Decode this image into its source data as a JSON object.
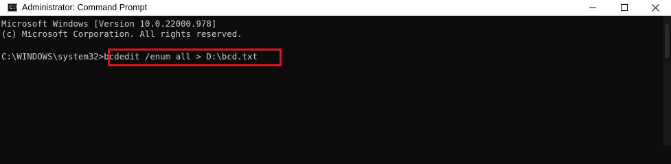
{
  "window": {
    "title": "Administrator: Command Prompt",
    "icon_label": "C:\\_"
  },
  "controls": {
    "minimize_icon": "minimize-icon",
    "maximize_icon": "maximize-icon",
    "close_icon": "close-icon"
  },
  "console": {
    "line1": "Microsoft Windows [Version 10.0.22000.978]",
    "line2": "(c) Microsoft Corporation. All rights reserved.",
    "prompt": "C:\\WINDOWS\\system32>",
    "command": "bcdedit /enum all > D:\\bcd.txt"
  },
  "colors": {
    "console_bg": "#0c0c0c",
    "console_text": "#cccccc",
    "highlight": "#e0141e",
    "titlebar_bg": "#ffffff"
  }
}
